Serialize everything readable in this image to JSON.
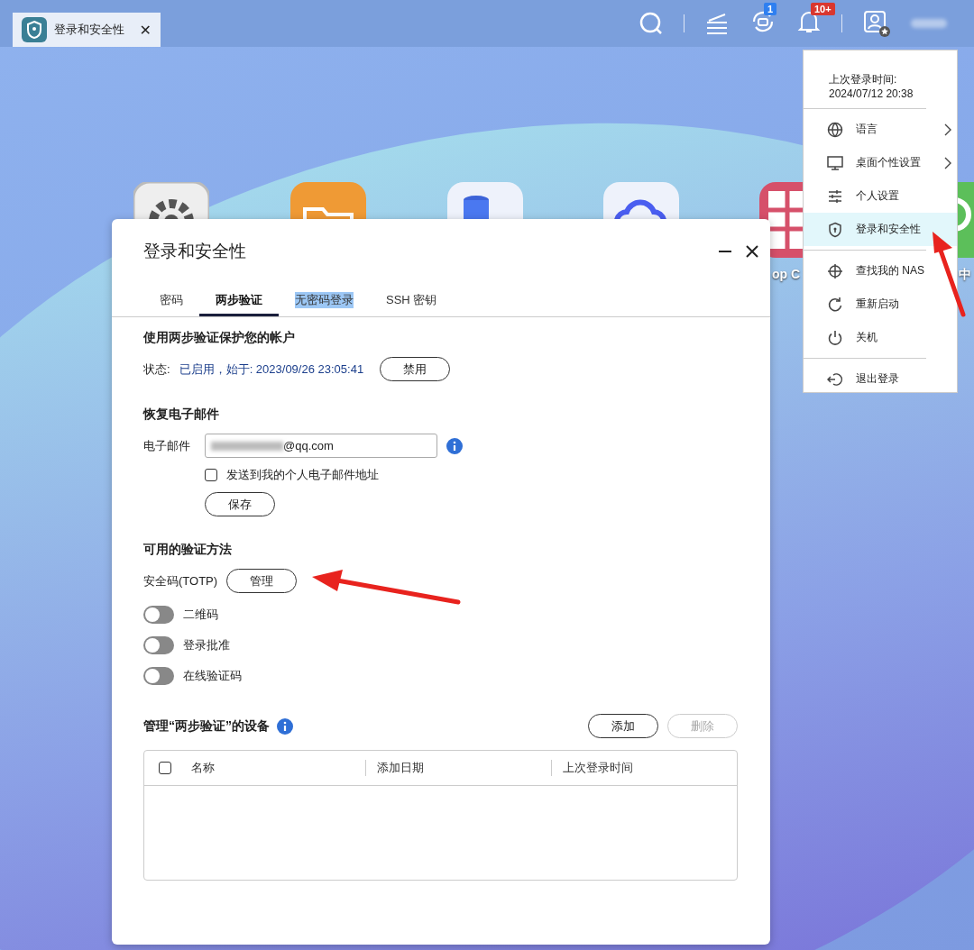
{
  "taskbar": {
    "tab": {
      "title": "登录和安全性",
      "close": "✕"
    },
    "sync_badge": "1",
    "notification_badge": "10+"
  },
  "desktop_apps": [
    {
      "kind": "gear"
    },
    {
      "kind": "folder"
    },
    {
      "kind": "database"
    },
    {
      "kind": "cloud"
    },
    {
      "kind": "grid",
      "label": "op C"
    },
    {
      "kind": "ring",
      "label": "中"
    }
  ],
  "dialog": {
    "title": "登录和安全性",
    "tabs": [
      {
        "label": "密码",
        "selected": false,
        "highlighted": false
      },
      {
        "label": "两步验证",
        "selected": true,
        "highlighted": false
      },
      {
        "label": "无密码登录",
        "selected": false,
        "highlighted": true
      },
      {
        "label": "SSH 密钥",
        "selected": false,
        "highlighted": false
      }
    ],
    "protect": {
      "heading": "使用两步验证保护您的帐户",
      "status_label": "状态:",
      "status_value": "已启用，始于: 2023/09/26 23:05:41",
      "button": "禁用"
    },
    "recovery": {
      "heading": "恢复电子邮件",
      "email_label": "电子邮件",
      "email_value": "@qq.com",
      "send_personal": {
        "label": "发送到我的个人电子邮件地址",
        "checked": false
      },
      "save_button": "保存"
    },
    "methods": {
      "heading": "可用的验证方法",
      "totp_label": "安全码(TOTP)",
      "manage_button": "管理",
      "toggles": [
        {
          "label": "二维码",
          "on": false
        },
        {
          "label": "登录批准",
          "on": false
        },
        {
          "label": "在线验证码",
          "on": false
        }
      ]
    },
    "devices": {
      "heading": "管理“两步验证”的设备",
      "add_button": "添加",
      "delete_button": {
        "label": "删除",
        "disabled": true
      },
      "table": {
        "select_all": {
          "checked": false
        },
        "columns": [
          "名称",
          "添加日期",
          "上次登录时间"
        ]
      }
    }
  },
  "user_menu": {
    "last_login_label": "上次登录时间:",
    "last_login_time": "2024/07/12 20:38",
    "groups": [
      [
        {
          "label": "语言",
          "kind": "globe",
          "submenu": true,
          "selected": false
        },
        {
          "label": "桌面个性设置",
          "kind": "monitor",
          "submenu": true,
          "selected": false
        },
        {
          "label": "个人设置",
          "kind": "sliders",
          "submenu": false,
          "selected": false
        },
        {
          "label": "登录和安全性",
          "kind": "shield",
          "submenu": false,
          "selected": true
        }
      ],
      [
        {
          "label": "查找我的 NAS",
          "kind": "crosshair",
          "submenu": false,
          "selected": false
        },
        {
          "label": "重新启动",
          "kind": "restart",
          "submenu": false,
          "selected": false
        },
        {
          "label": "关机",
          "kind": "power",
          "submenu": false,
          "selected": false
        }
      ],
      [
        {
          "label": "退出登录",
          "kind": "logout",
          "submenu": false,
          "selected": false
        }
      ]
    ]
  }
}
